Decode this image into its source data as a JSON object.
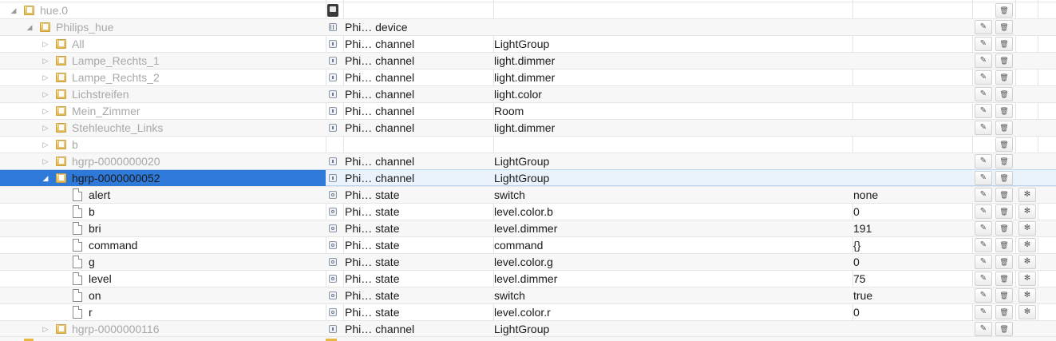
{
  "colors": {
    "selection": "#2f7ad9",
    "folder": "#e8b742",
    "stripe": "#f7f7f7"
  },
  "icons": {
    "edit": "pencil-icon",
    "delete": "trash-icon",
    "settings": "gear-icon",
    "expanded": "triangle-down-icon",
    "collapsed": "triangle-right-icon"
  },
  "rows": [
    {
      "name": "hue.0",
      "depth": 0,
      "kind": "folder",
      "toggle": "expanded",
      "muted": true,
      "icon": "adapter",
      "type": "",
      "role": "",
      "value": "",
      "edit": false,
      "delete": true,
      "settings": false
    },
    {
      "name": "Philips_hue",
      "depth": 1,
      "kind": "folder",
      "toggle": "expanded",
      "muted": true,
      "icon": "device",
      "type": "Phi… device",
      "role": "",
      "value": "",
      "edit": true,
      "delete": true,
      "settings": false
    },
    {
      "name": "All",
      "depth": 2,
      "kind": "folder",
      "toggle": "collapsed",
      "muted": true,
      "icon": "channel",
      "type": "Phi… channel",
      "role": "LightGroup",
      "value": "",
      "edit": true,
      "delete": true,
      "settings": false
    },
    {
      "name": "Lampe_Rechts_1",
      "depth": 2,
      "kind": "folder",
      "toggle": "collapsed",
      "muted": true,
      "icon": "channel",
      "type": "Phi… channel",
      "role": "light.dimmer",
      "value": "",
      "edit": true,
      "delete": true,
      "settings": false
    },
    {
      "name": "Lampe_Rechts_2",
      "depth": 2,
      "kind": "folder",
      "toggle": "collapsed",
      "muted": true,
      "icon": "channel",
      "type": "Phi… channel",
      "role": "light.dimmer",
      "value": "",
      "edit": true,
      "delete": true,
      "settings": false
    },
    {
      "name": "Lichstreifen",
      "depth": 2,
      "kind": "folder",
      "toggle": "collapsed",
      "muted": true,
      "icon": "channel",
      "type": "Phi… channel",
      "role": "light.color",
      "value": "",
      "edit": true,
      "delete": true,
      "settings": false
    },
    {
      "name": "Mein_Zimmer",
      "depth": 2,
      "kind": "folder",
      "toggle": "collapsed",
      "muted": true,
      "icon": "channel",
      "type": "Phi… channel",
      "role": "Room",
      "value": "",
      "edit": true,
      "delete": true,
      "settings": false
    },
    {
      "name": "Stehleuchte_Links",
      "depth": 2,
      "kind": "folder",
      "toggle": "collapsed",
      "muted": true,
      "icon": "channel",
      "type": "Phi… channel",
      "role": "light.dimmer",
      "value": "",
      "edit": true,
      "delete": true,
      "settings": false
    },
    {
      "name": "b",
      "depth": 2,
      "kind": "folder",
      "toggle": "collapsed",
      "muted": true,
      "icon": "",
      "type": "",
      "role": "",
      "value": "",
      "edit": false,
      "delete": true,
      "settings": false
    },
    {
      "name": "hgrp-0000000020",
      "depth": 2,
      "kind": "folder",
      "toggle": "collapsed",
      "muted": true,
      "icon": "channel",
      "type": "Phi… channel",
      "role": "LightGroup",
      "value": "",
      "edit": true,
      "delete": true,
      "settings": false
    },
    {
      "name": "hgrp-0000000052",
      "depth": 2,
      "kind": "folder",
      "toggle": "expanded",
      "muted": false,
      "selected": true,
      "icon": "channel",
      "type": "Phi… channel",
      "role": "LightGroup",
      "value": "",
      "edit": true,
      "delete": true,
      "settings": false
    },
    {
      "name": "alert",
      "depth": 3,
      "kind": "file",
      "toggle": "",
      "muted": false,
      "icon": "state",
      "type": "Phi… state",
      "role": "switch",
      "value": "none",
      "edit": true,
      "delete": true,
      "settings": true
    },
    {
      "name": "b",
      "depth": 3,
      "kind": "file",
      "toggle": "",
      "muted": false,
      "icon": "state",
      "type": "Phi… state",
      "role": "level.color.b",
      "value": "0",
      "edit": true,
      "delete": true,
      "settings": true
    },
    {
      "name": "bri",
      "depth": 3,
      "kind": "file",
      "toggle": "",
      "muted": false,
      "icon": "state",
      "type": "Phi… state",
      "role": "level.dimmer",
      "value": "191",
      "edit": true,
      "delete": true,
      "settings": true
    },
    {
      "name": "command",
      "depth": 3,
      "kind": "file",
      "toggle": "",
      "muted": false,
      "icon": "state",
      "type": "Phi… state",
      "role": "command",
      "value": "{}",
      "edit": true,
      "delete": true,
      "settings": true
    },
    {
      "name": "g",
      "depth": 3,
      "kind": "file",
      "toggle": "",
      "muted": false,
      "icon": "state",
      "type": "Phi… state",
      "role": "level.color.g",
      "value": "0",
      "edit": true,
      "delete": true,
      "settings": true
    },
    {
      "name": "level",
      "depth": 3,
      "kind": "file",
      "toggle": "",
      "muted": false,
      "icon": "state",
      "type": "Phi… state",
      "role": "level.dimmer",
      "value": "75",
      "edit": true,
      "delete": true,
      "settings": true
    },
    {
      "name": "on",
      "depth": 3,
      "kind": "file",
      "toggle": "",
      "muted": false,
      "icon": "state",
      "type": "Phi… state",
      "role": "switch",
      "value": "true",
      "edit": true,
      "delete": true,
      "settings": true
    },
    {
      "name": "r",
      "depth": 3,
      "kind": "file",
      "toggle": "",
      "muted": false,
      "icon": "state",
      "type": "Phi… state",
      "role": "level.color.r",
      "value": "0",
      "edit": true,
      "delete": true,
      "settings": true
    },
    {
      "name": "hgrp-0000000116",
      "depth": 2,
      "kind": "folder",
      "toggle": "collapsed",
      "muted": true,
      "icon": "channel",
      "type": "Phi… channel",
      "role": "LightGroup",
      "value": "",
      "edit": true,
      "delete": true,
      "settings": false
    }
  ]
}
